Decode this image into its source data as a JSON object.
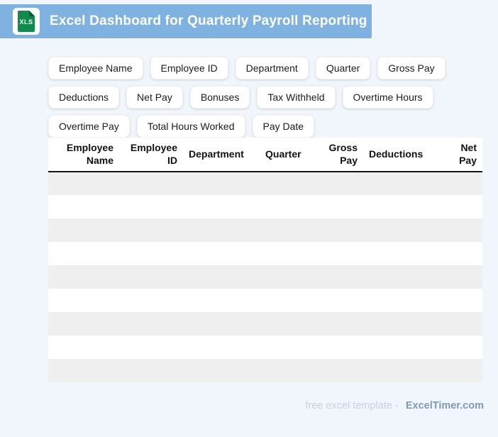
{
  "header": {
    "title": "Excel Dashboard for Quarterly Payroll Reporting",
    "file_icon_label": "XLS"
  },
  "colors": {
    "banner_blue": "#7FB1E1",
    "icon_green": "#128A4E",
    "stripe_gray": "#EFEFEF",
    "page_background": "#F0F6FC",
    "brand_text": "#8299B4",
    "muted_text": "#C9D1DC"
  },
  "chips": [
    "Employee Name",
    "Employee ID",
    "Department",
    "Quarter",
    "Gross Pay",
    "Deductions",
    "Net Pay",
    "Bonuses",
    "Tax Withheld",
    "Overtime Hours",
    "Overtime Pay",
    "Total Hours Worked",
    "Pay Date"
  ],
  "table": {
    "columns": [
      "Employee Name",
      "Employee ID",
      "Department",
      "Quarter",
      "Gross Pay",
      "Deductions",
      "Net Pay"
    ],
    "empty_row_count": 9
  },
  "footer": {
    "prefix": "free excel template -",
    "brand": "ExcelTimer.com"
  }
}
